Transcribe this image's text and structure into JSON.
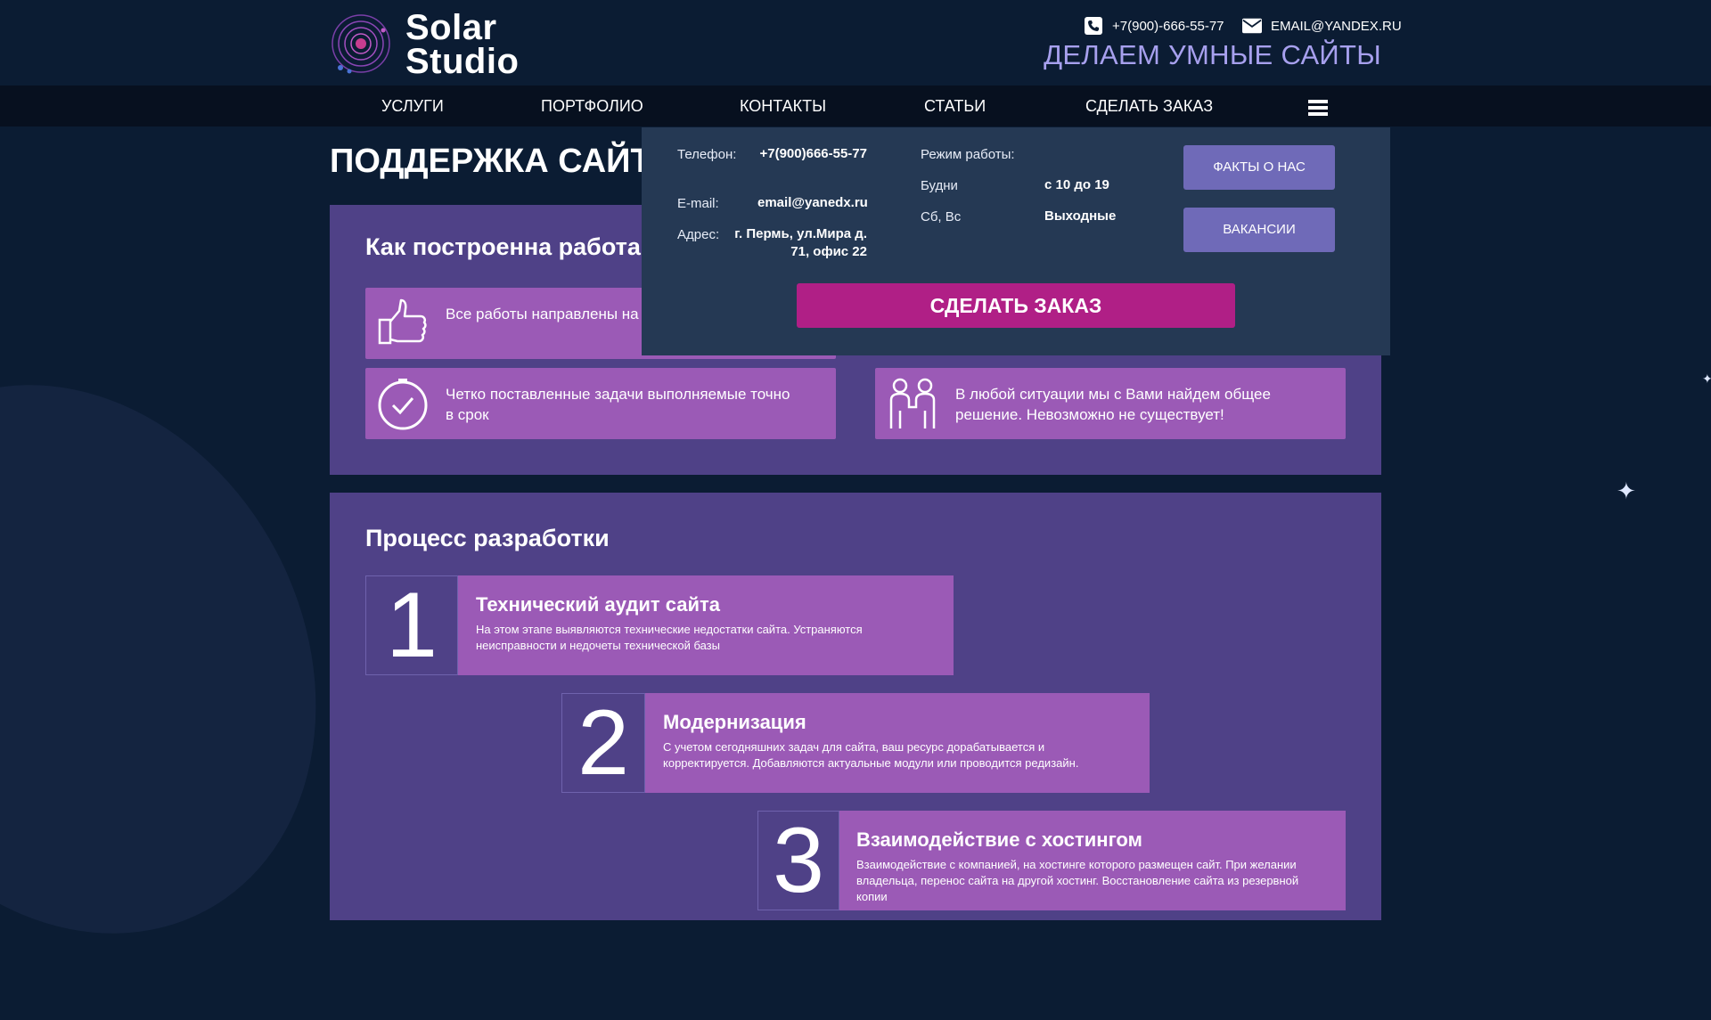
{
  "brand": {
    "line1": "Solar",
    "line2": "Studio"
  },
  "header": {
    "phone": "+7(900)-666-55-77",
    "email": "EMAIL@YANDEX.RU",
    "tagline": "ДЕЛАЕМ УМНЫЕ САЙТЫ"
  },
  "nav": {
    "items": [
      "УСЛУГИ",
      "ПОРТФОЛИО",
      "КОНТАКТЫ",
      "СТАТЬИ",
      "СДЕЛАТЬ ЗАКАЗ"
    ]
  },
  "page": {
    "title": "ПОДДЕРЖКА САЙТОВ"
  },
  "how_work": {
    "heading": "Как построенна работа",
    "cards": [
      {
        "icon": "thumbs-up-icon",
        "text": "Все работы направлены на Ваших клиентов"
      },
      {
        "icon": "clock-check-icon",
        "text": "Четко поставленные задачи выполняемые точно в срок"
      },
      {
        "icon": "handshake-people-icon",
        "text": "В любой ситуации мы с Вами найдем общее решение. Невозможно не существует!"
      }
    ]
  },
  "process": {
    "heading": "Процесс разработки",
    "steps": [
      {
        "num": "1",
        "title": "Технический аудит сайта",
        "desc": "На этом этапе выявляются технические недостатки сайта. Устраняются неисправности и недочеты технической базы"
      },
      {
        "num": "2",
        "title": "Модернизация",
        "desc": "С учетом сегодняшних задач для сайта, ваш ресурс дорабатывается и корректируется. Добавляются актуальные модули или проводится редизайн."
      },
      {
        "num": "3",
        "title": "Взаимодействие с хостингом",
        "desc": "Взаимодействие с компанией, на хостинге которого размещен сайт. При желании владельца, перенос сайта на другой хостинг. Восстановление сайта из резервной копии"
      }
    ]
  },
  "dropdown": {
    "phone_label": "Телефон:",
    "phone_value": "+7(900)666-55-77",
    "email_label": "E-mail:",
    "email_value": "email@yanedx.ru",
    "address_label": "Адрес:",
    "address_value": "г. Пермь, ул.Мира д. 71, офис 22",
    "schedule_label": "Режим работы:",
    "weekdays_label": "Будни",
    "weekdays_value": "с 10 до 19",
    "weekend_label": "Сб, Вс",
    "weekend_value": "Выходные",
    "facts_button": "ФАКТЫ О НАС",
    "vacancies_button": "ВАКАНСИИ",
    "order_button": "СДЕЛАТЬ ЗАКАЗ"
  },
  "colors": {
    "background": "#0b1c33",
    "panel": "#4f4187",
    "card": "#9b5ab6",
    "accent": "#b01f86",
    "tagline": "#a7a0ee",
    "dropdown": "#253954"
  }
}
